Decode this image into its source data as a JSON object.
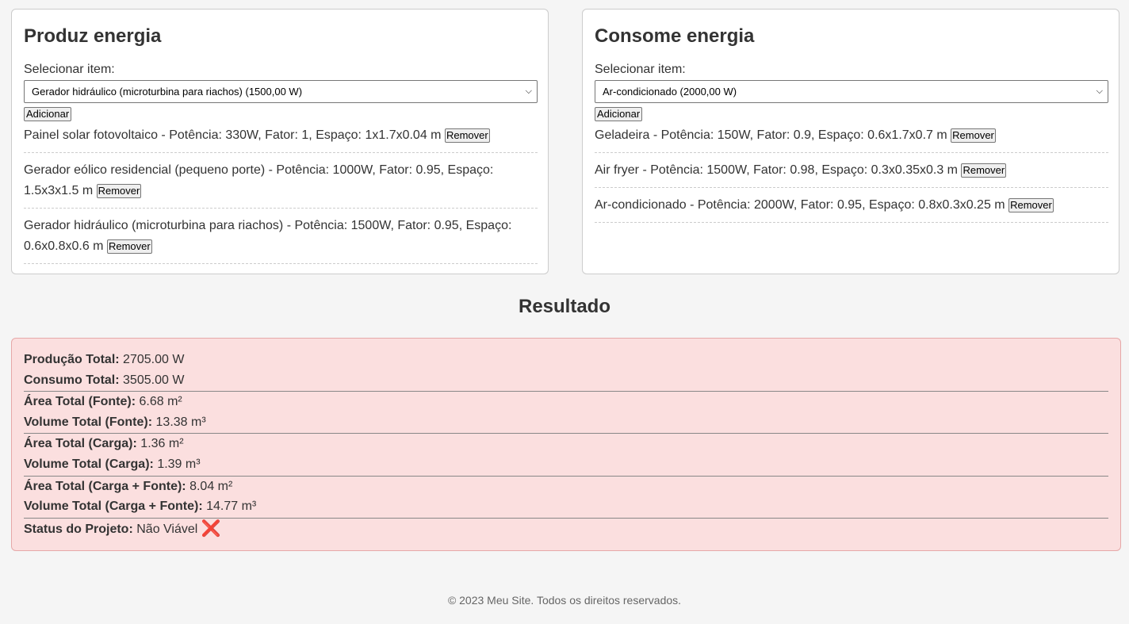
{
  "produz": {
    "title": "Produz energia",
    "select_label": "Selecionar item:",
    "selected_option": "Gerador hidráulico (microturbina para riachos) (1500,00 W)",
    "add_label": "Adicionar",
    "items": [
      {
        "text": "Painel solar fotovoltaico - Potência: 330W, Fator: 1, Espaço: 1x1.7x0.04 m",
        "remove_label": "Remover"
      },
      {
        "text": "Gerador eólico residencial (pequeno porte) - Potência: 1000W, Fator: 0.95, Espaço: 1.5x3x1.5 m",
        "remove_label": "Remover"
      },
      {
        "text": "Gerador hidráulico (microturbina para riachos) - Potência: 1500W, Fator: 0.95, Espaço: 0.6x0.8x0.6 m",
        "remove_label": "Remover"
      }
    ]
  },
  "consome": {
    "title": "Consome energia",
    "select_label": "Selecionar item:",
    "selected_option": "Ar-condicionado (2000,00 W)",
    "add_label": "Adicionar",
    "items": [
      {
        "text": "Geladeira - Potência: 150W, Fator: 0.9, Espaço: 0.6x1.7x0.7 m",
        "remove_label": "Remover"
      },
      {
        "text": "Air fryer - Potência: 1500W, Fator: 0.98, Espaço: 0.3x0.35x0.3 m",
        "remove_label": "Remover"
      },
      {
        "text": "Ar-condicionado - Potência: 2000W, Fator: 0.95, Espaço: 0.8x0.3x0.25 m",
        "remove_label": "Remover"
      }
    ]
  },
  "resultado": {
    "title": "Resultado",
    "producao_total": {
      "label": "Produção Total:",
      "value": "2705.00 W"
    },
    "consumo_total": {
      "label": "Consumo Total:",
      "value": "3505.00 W"
    },
    "area_fonte": {
      "label": "Área Total (Fonte):",
      "value": "6.68 m²"
    },
    "volume_fonte": {
      "label": "Volume Total (Fonte):",
      "value": "13.38 m³"
    },
    "area_carga": {
      "label": "Área Total (Carga):",
      "value": "1.36 m²"
    },
    "volume_carga": {
      "label": "Volume Total (Carga):",
      "value": "1.39 m³"
    },
    "area_total": {
      "label": "Área Total (Carga + Fonte):",
      "value": "8.04 m²"
    },
    "volume_total": {
      "label": "Volume Total (Carga + Fonte):",
      "value": "14.77 m³"
    },
    "status": {
      "label": "Status do Projeto:",
      "value": "Não Viável",
      "icon": "cross-mark-icon"
    },
    "colors": {
      "background": "#fbdfdf",
      "border": "#e6a8a8"
    }
  },
  "footer": "© 2023 Meu Site. Todos os direitos reservados."
}
